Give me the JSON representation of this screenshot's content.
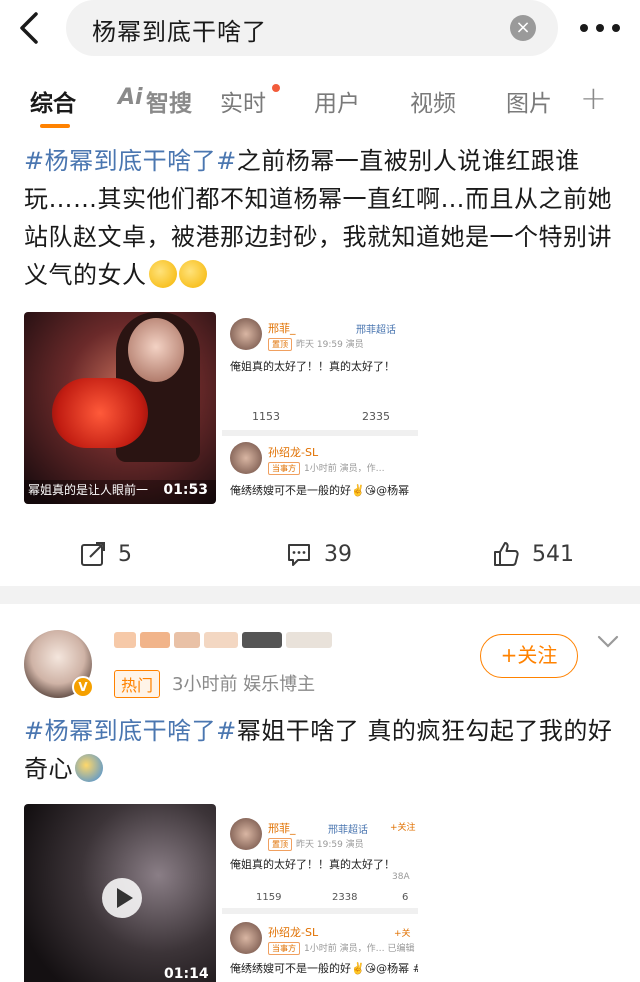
{
  "search": {
    "query": "杨幂到底干啥了",
    "clear_glyph": "×"
  },
  "tabs": [
    {
      "label": "综合"
    },
    {
      "label": "智搜"
    },
    {
      "label": "实时"
    },
    {
      "label": "用户"
    },
    {
      "label": "视频"
    },
    {
      "label": "图片"
    }
  ],
  "ai_logo": "Ai",
  "plus_glyph": "+",
  "post1": {
    "tag": "#杨幂到底干啥了#",
    "text": "之前杨幂一直被别人说谁红跟谁玩……其实他们都不知道杨幂一直红啊…而且从之前她站队赵文卓，被港那边封砂，我就知道她是一个特别讲义气的女人",
    "video": {
      "caption": "幂姐真的是让人眼前一",
      "time": "01:53"
    },
    "screenshot": {
      "card1": {
        "name": "邢菲_",
        "link": "邢菲超话",
        "badge": "置顶",
        "meta": "昨天 19:59 演员",
        "body": "俺姐真的太好了！！真的太好了！",
        "stat1": "1153",
        "stat2": "2335"
      },
      "card2": {
        "name": "孙绍龙-SL",
        "badge": "当事方",
        "meta": "1小时前 演员，作…",
        "body": "俺绣绣嫂可不是一般的好✌️😘@杨幂"
      }
    },
    "actions": {
      "repost": "5",
      "comment": "39",
      "like": "541"
    }
  },
  "post2": {
    "hot_badge": "热门",
    "meta": "3小时前  娱乐博主",
    "follow_label": "+关注",
    "tag": "#杨幂到底干啥了#",
    "text": "幂姐干啥了 真的疯狂勾起了我的好奇心",
    "video": {
      "time": "01:14"
    },
    "screenshot": {
      "card1": {
        "name": "邢菲_",
        "link": "邢菲超话",
        "follow": "+关注",
        "badge": "置顶",
        "meta": "昨天 19:59 演员",
        "body": "俺姐真的太好了！！真的太好了！",
        "stat1": "1159",
        "stat2": "2338",
        "count": "38A",
        "stat3": "6"
      },
      "card2": {
        "name": "孙绍龙-SL",
        "follow": "+关",
        "badge": "当事方",
        "meta": "1小时前 演员，作… 已编辑",
        "body": "俺绣绣嫂可不是一般的好✌️😘@杨幂 #生万物"
      }
    }
  }
}
